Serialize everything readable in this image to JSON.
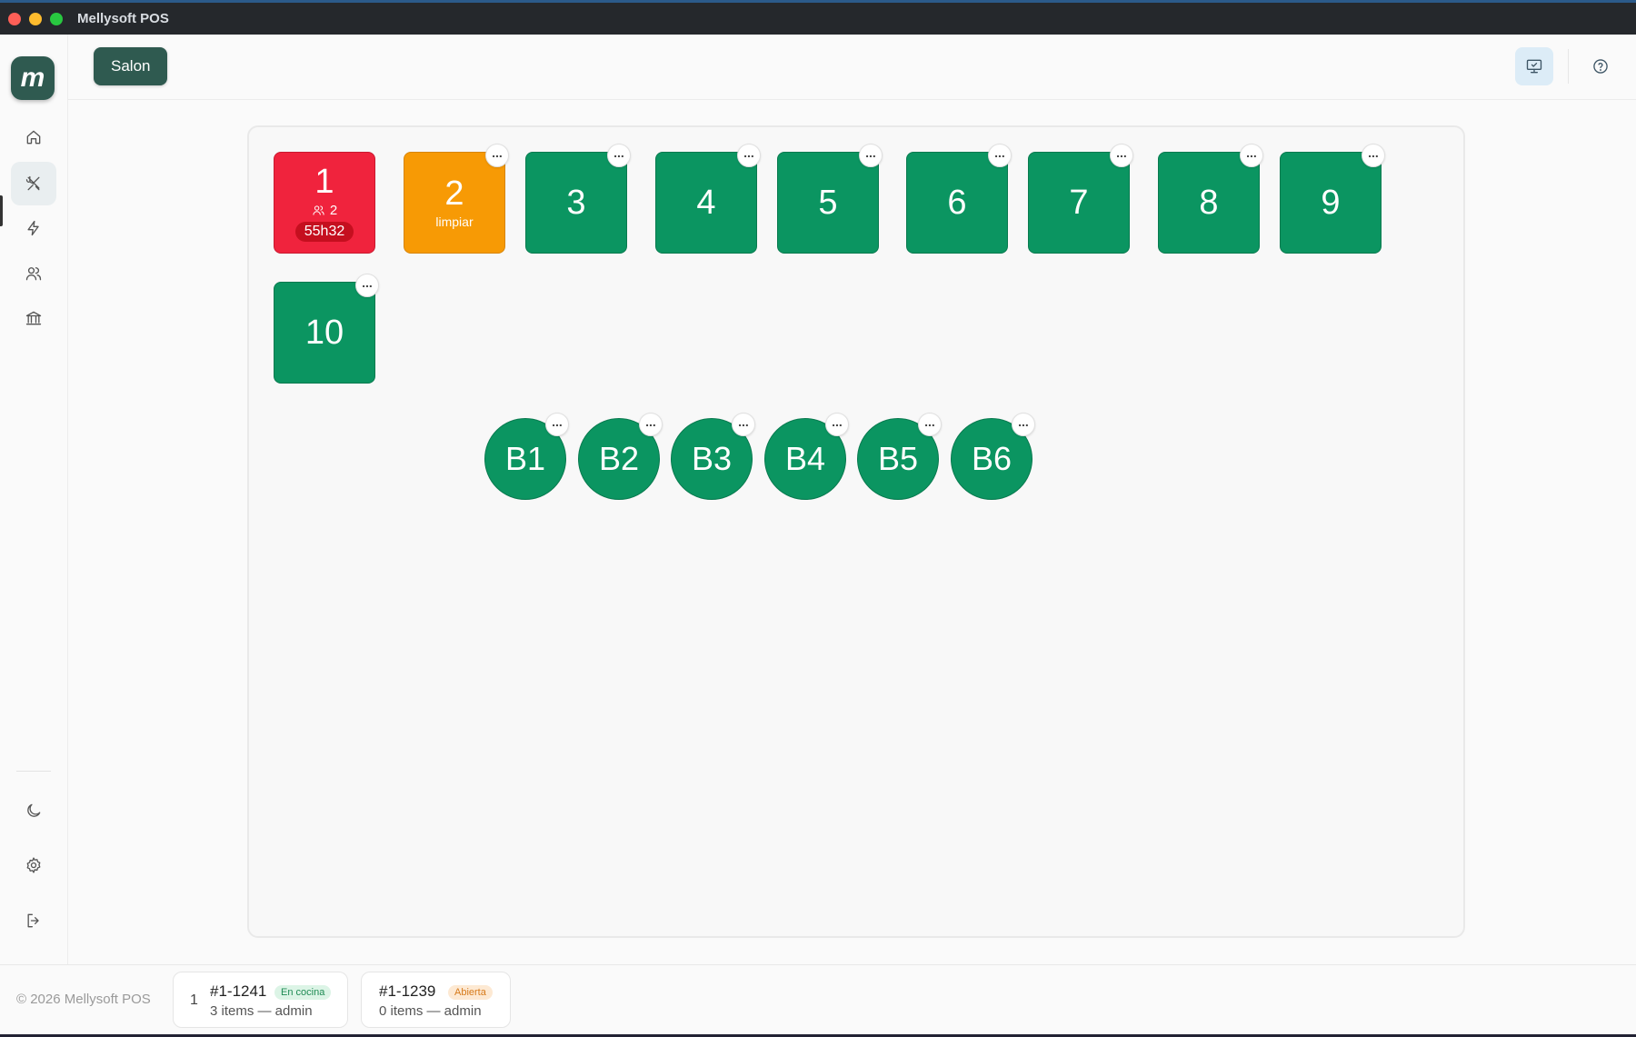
{
  "window": {
    "title": "Mellysoft POS"
  },
  "logo": {
    "letter": "m"
  },
  "header": {
    "room_button": "Salon"
  },
  "tables": [
    {
      "num": "1",
      "status": "occupied",
      "guests": "2",
      "timer": "55h32"
    },
    {
      "num": "2",
      "status": "cleaning",
      "note": "limpiar"
    },
    {
      "num": "3",
      "status": "free"
    },
    {
      "num": "4",
      "status": "free"
    },
    {
      "num": "5",
      "status": "free"
    },
    {
      "num": "6",
      "status": "free"
    },
    {
      "num": "7",
      "status": "free"
    },
    {
      "num": "8",
      "status": "free"
    },
    {
      "num": "9",
      "status": "free"
    },
    {
      "num": "10",
      "status": "free"
    }
  ],
  "bar_stools": [
    "B1",
    "B2",
    "B3",
    "B4",
    "B5",
    "B6"
  ],
  "colors": {
    "free": "#0b9561",
    "occupied": "#f0233d",
    "cleaning": "#f79a05",
    "brand": "#2f5a50"
  },
  "footer": {
    "copyright": "© 2026 Mellysoft POS",
    "orders": [
      {
        "table": "1",
        "id": "#1-1241",
        "status": "En cocina",
        "meta": "3 items — admin"
      },
      {
        "id": "#1-1239",
        "status": "Abierta",
        "meta": "0 items — admin"
      }
    ]
  }
}
